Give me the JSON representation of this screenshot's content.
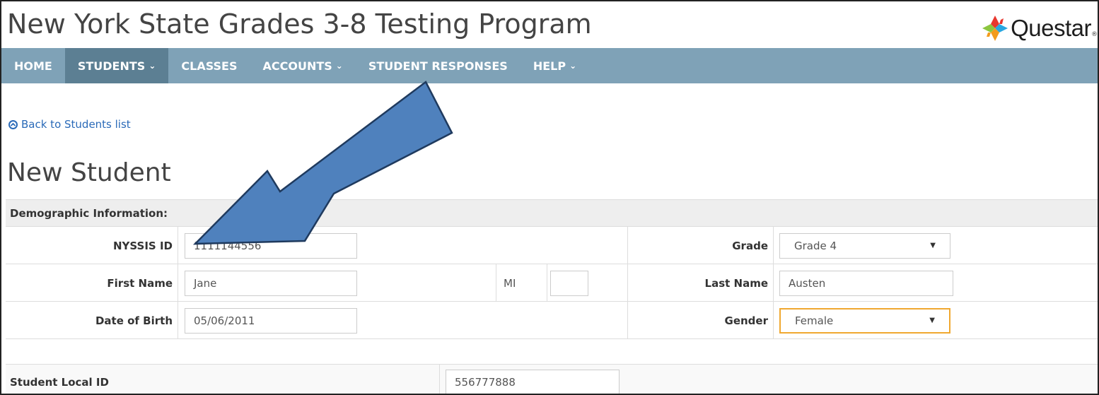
{
  "header": {
    "title": "New York State Grades 3-8 Testing Program",
    "logo_text": "Questar",
    "logo_mark": "®"
  },
  "nav": {
    "items": [
      {
        "label": "HOME",
        "has_dropdown": false,
        "active": false
      },
      {
        "label": "STUDENTS",
        "has_dropdown": true,
        "active": true
      },
      {
        "label": "CLASSES",
        "has_dropdown": false,
        "active": false
      },
      {
        "label": "ACCOUNTS",
        "has_dropdown": true,
        "active": false
      },
      {
        "label": "STUDENT RESPONSES",
        "has_dropdown": false,
        "active": false
      },
      {
        "label": "HELP",
        "has_dropdown": true,
        "active": false
      }
    ],
    "chevron": "⌄"
  },
  "back_link": {
    "label": "Back to Students list",
    "icon": "⊖"
  },
  "page_title": "New Student",
  "form": {
    "section_title": "Demographic Information:",
    "nyssis_id": {
      "label": "NYSSIS ID",
      "value": "1111144556"
    },
    "grade": {
      "label": "Grade",
      "value": "Grade 4"
    },
    "first_name": {
      "label": "First Name",
      "value": "Jane"
    },
    "mi": {
      "label": "MI",
      "value": ""
    },
    "last_name": {
      "label": "Last Name",
      "value": "Austen"
    },
    "dob": {
      "label": "Date of Birth",
      "value": "05/06/2011"
    },
    "gender": {
      "label": "Gender",
      "value": "Female"
    },
    "local_id": {
      "label": "Student Local ID",
      "value": "556777888"
    }
  },
  "select_caret": "▼",
  "colors": {
    "nav_bg": "#7fa2b7",
    "nav_active_bg": "#5c7f93",
    "arrow_fill": "#4f81bd",
    "arrow_stroke": "#1f3a5e",
    "focus_border": "#f0a830",
    "link": "#2a6ab8"
  }
}
